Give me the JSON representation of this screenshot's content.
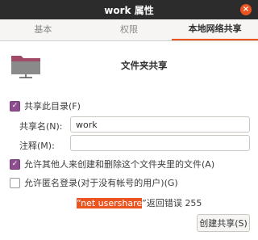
{
  "window": {
    "title": "work 属性",
    "close_glyph": "×"
  },
  "tabs": [
    {
      "label": "基本"
    },
    {
      "label": "权限"
    },
    {
      "label": "本地网络共享"
    }
  ],
  "share": {
    "folder_icon": "folder-icon",
    "heading": "文件夹共享",
    "share_checkbox": {
      "label": "共享此目录(F)",
      "checked": true
    },
    "share_name": {
      "label": "共享名(N):",
      "value": "work"
    },
    "comment": {
      "label": "注释(M):",
      "value": ""
    },
    "allow_others": {
      "label": "允许其他人来创建和删除这个文件夹里的文件(A)",
      "checked": true
    },
    "guest": {
      "label": "允许匿名登录(对于没有帐号的用户)(G)",
      "checked": false
    },
    "error": {
      "quote_open": "“",
      "command": "net usershare",
      "suffix": "”返回错误 255"
    },
    "create_button": "创建共享(S)"
  },
  "colors": {
    "accent": "#e95420",
    "checkbox": "#8c4f8e",
    "titlebar": "#2c2c2c"
  }
}
